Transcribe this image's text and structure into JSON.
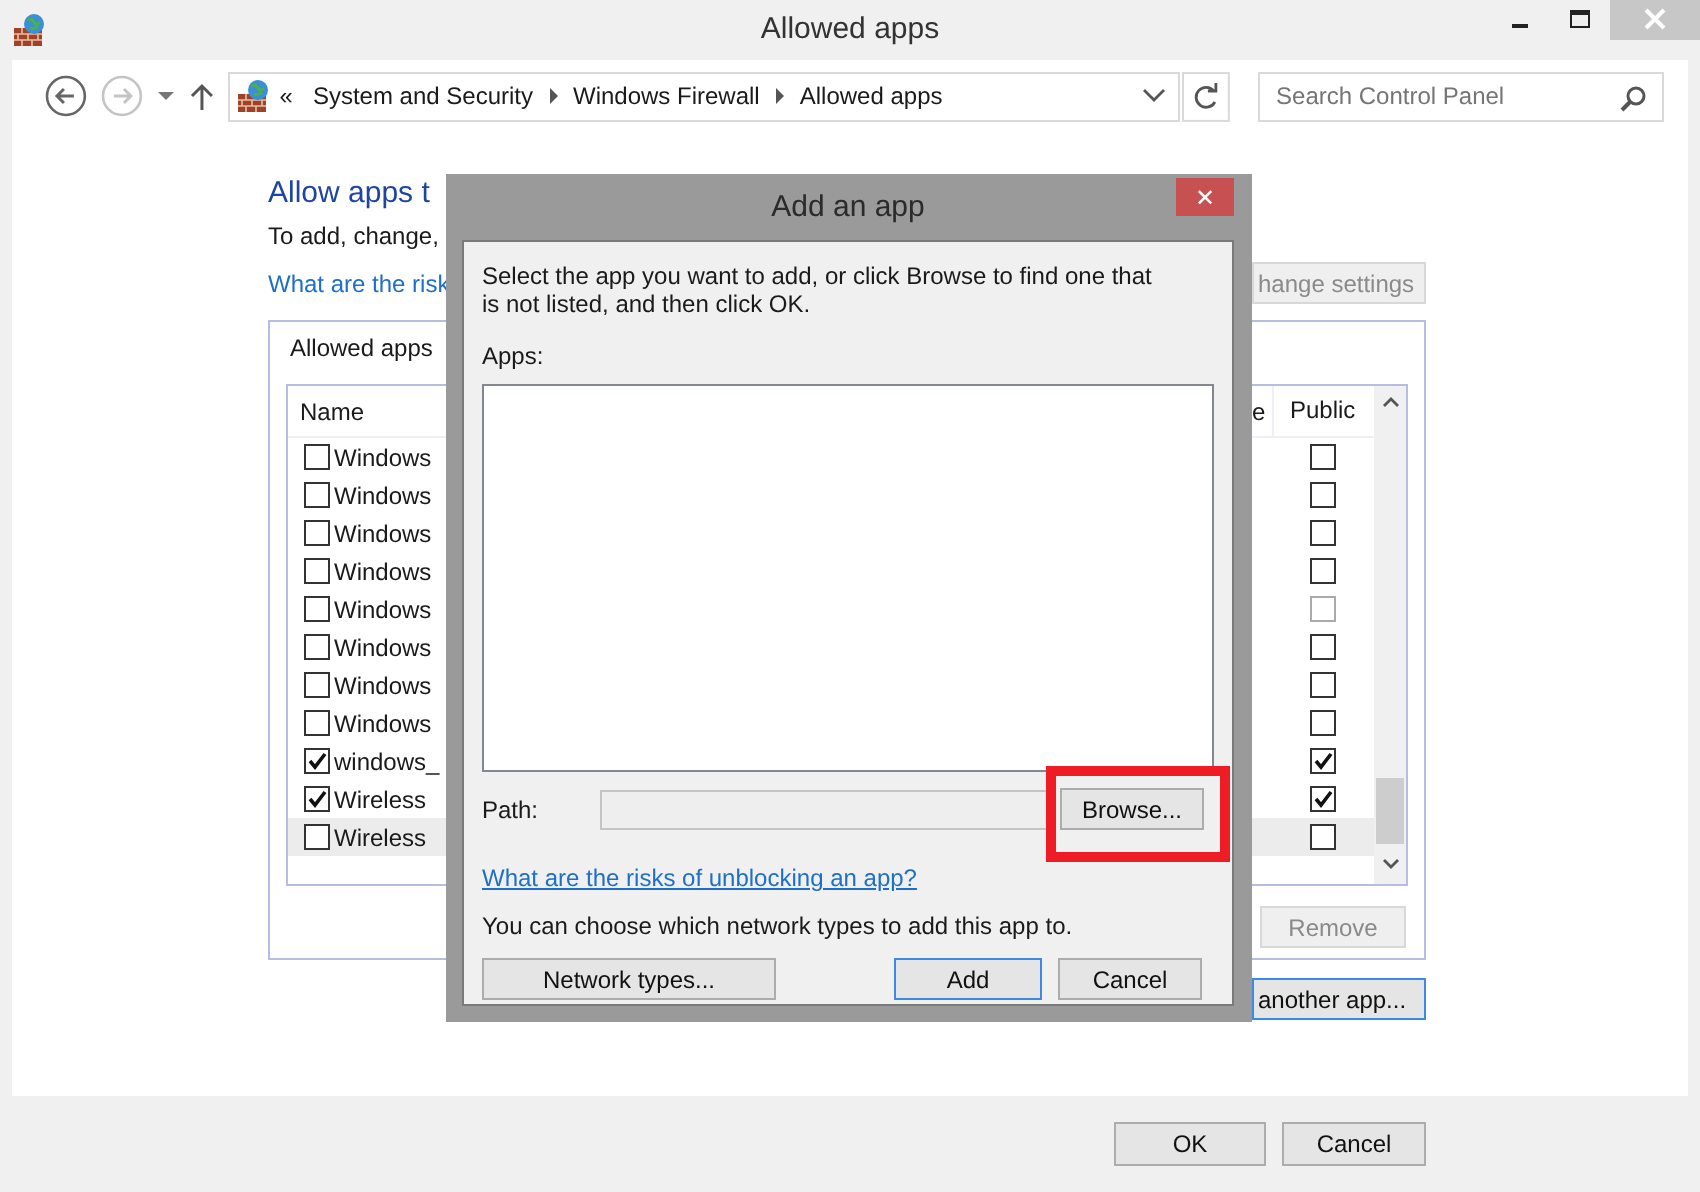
{
  "window": {
    "title": "Allowed apps"
  },
  "address_bar": {
    "prefix": "«",
    "crumbs": [
      "System and Security",
      "Windows Firewall",
      "Allowed apps"
    ]
  },
  "search": {
    "placeholder": "Search Control Panel"
  },
  "page": {
    "heading": "Allow apps t",
    "description": "To add, change,",
    "risk_link": "What are the risk",
    "change_settings_button": {
      "label": "hange settings",
      "disabled": true
    }
  },
  "group": {
    "title": "Allowed apps",
    "columns": [
      "Name",
      "e",
      "Public"
    ],
    "rows": [
      {
        "name": "Windows",
        "checked": false,
        "public": false,
        "public_disabled": false,
        "hovered": false
      },
      {
        "name": "Windows",
        "checked": false,
        "public": false,
        "public_disabled": false,
        "hovered": false
      },
      {
        "name": "Windows",
        "checked": false,
        "public": false,
        "public_disabled": false,
        "hovered": false
      },
      {
        "name": "Windows",
        "checked": false,
        "public": false,
        "public_disabled": false,
        "hovered": false
      },
      {
        "name": "Windows",
        "checked": false,
        "public": false,
        "public_disabled": true,
        "hovered": false
      },
      {
        "name": "Windows",
        "checked": false,
        "public": false,
        "public_disabled": false,
        "hovered": false
      },
      {
        "name": "Windows",
        "checked": false,
        "public": false,
        "public_disabled": false,
        "hovered": false
      },
      {
        "name": "Windows",
        "checked": false,
        "public": false,
        "public_disabled": false,
        "hovered": false
      },
      {
        "name": "windows_",
        "checked": true,
        "public": true,
        "public_disabled": false,
        "hovered": false
      },
      {
        "name": "Wireless",
        "checked": true,
        "public": true,
        "public_disabled": false,
        "hovered": false
      },
      {
        "name": "Wireless",
        "checked": false,
        "public": false,
        "public_disabled": false,
        "hovered": true
      }
    ],
    "remove_button": {
      "label": "Remove",
      "disabled": true
    }
  },
  "another_app_button": "another app...",
  "footer_buttons": [
    "OK",
    "Cancel"
  ],
  "dialog": {
    "title": "Add an app",
    "close": "✕",
    "instructions": "Select the app you want to add, or click Browse to find one that is not listed, and then click OK.",
    "apps_label": "Apps:",
    "path_label": "Path:",
    "browse_button": "Browse...",
    "risk_link": "What are the risks of unblocking an app?",
    "network_note": "You can choose which network types to add this app to.",
    "network_types_button": "Network types...",
    "add_button": "Add",
    "cancel_button": "Cancel"
  }
}
